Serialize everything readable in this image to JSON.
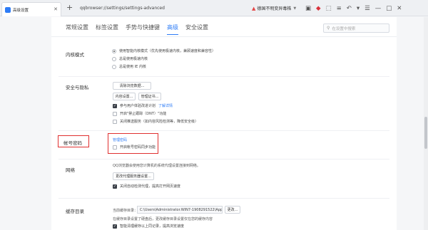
{
  "browser": {
    "tab_title": "高级设置",
    "new_tab_label": "+",
    "address": "qqbrowser://settings/settings-advanced",
    "warning_text": "德国不明变异毒株",
    "toolbar_icons": [
      "qr-icon",
      "translate-icon",
      "extensions-icon",
      "menu-icon",
      "undo-icon",
      "dropdown-icon",
      "menu-icon",
      "minimize-icon",
      "maximize-icon",
      "close-icon"
    ]
  },
  "nav": {
    "tabs": [
      "常规设置",
      "标签设置",
      "手势与快捷键",
      "高级",
      "安全设置"
    ],
    "active_index": 3,
    "search_placeholder": "在设置中搜索"
  },
  "kernel": {
    "label": "内核模式",
    "options": [
      {
        "text": "使用智能内核模式（优先使用极速内核，兼顾速度和兼容性）",
        "selected": true
      },
      {
        "text": "总是使用极速内核",
        "selected": false
      },
      {
        "text": "总是使用 IE 内核",
        "selected": false
      }
    ]
  },
  "security": {
    "label": "安全与隐私",
    "clear_button": "清除浏览数据...",
    "content_button": "内容设置...",
    "cert_button": "管理证书...",
    "checks": [
      {
        "text": "参与用户体验改进计划",
        "checked": true,
        "link": "了解详情"
      },
      {
        "text": "开启\"禁止跟踪（DNT）\"功能",
        "checked": false
      },
      {
        "text": "关闭推送服务（如内容风险检测等，降低安全级）",
        "checked": false
      }
    ]
  },
  "account": {
    "label": "帐号密码",
    "manage_link": "管理密码",
    "check_text": "开启帐号密码同步功能",
    "checked": false
  },
  "network": {
    "label": "网络",
    "desc": "QQ浏览器会使用您计算机的系统代理设置连接到网络。",
    "proxy_button": "更改代理服务器设置...",
    "check_text": "关闭自动检测代理，提高打开网页速度",
    "checked": true
  },
  "cache": {
    "label": "缓存目录",
    "current_label": "当前缓存目录：",
    "path": "C:\\Users\\Administrator.WIN7-1908291522\\AppData",
    "change_button": "更改...",
    "note": "在缓存目录设置了硬盘后，更改缓存目录设置仅在您的缓存内容",
    "check_text": "智能清理缓存以上同记录，提高浏览速度",
    "checked": true
  }
}
